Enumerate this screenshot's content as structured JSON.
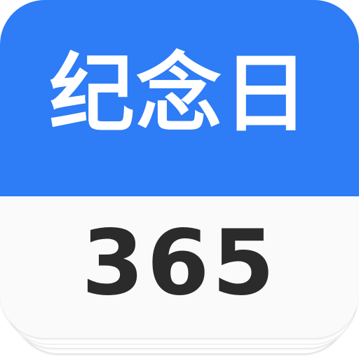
{
  "app_icon": {
    "title": "纪念日",
    "number": "365",
    "colors": {
      "header": "#2E7CF6",
      "number_text": "#2B2B2B",
      "title_text": "#FFFFFF",
      "card_body": "#FAFAFA"
    }
  }
}
